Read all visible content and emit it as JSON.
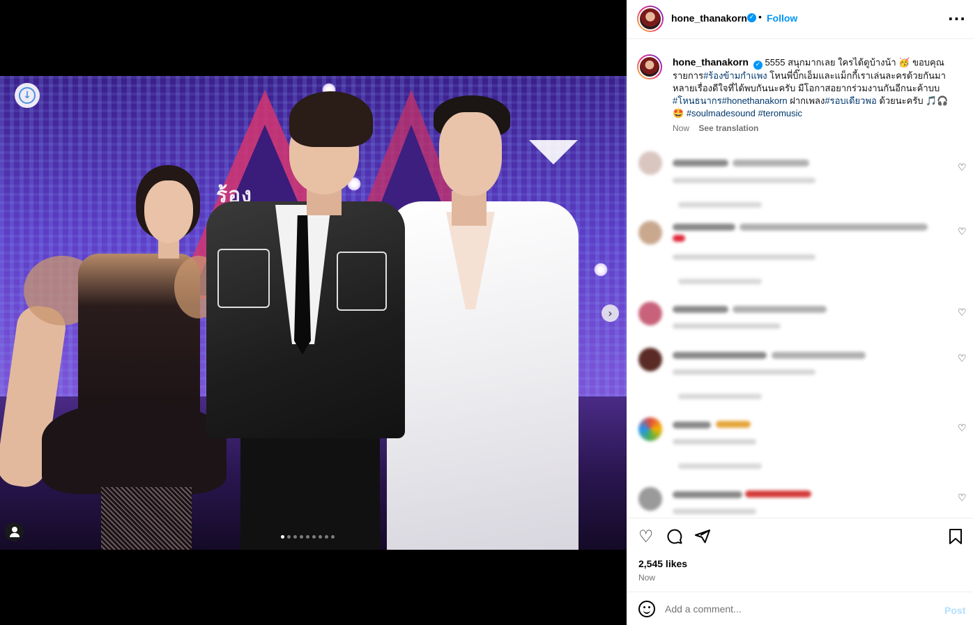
{
  "post": {
    "author": "hone_thanakorn",
    "follow_label": "Follow",
    "separator": "•",
    "more_icon": "more-horizontal-icon"
  },
  "media": {
    "stage_logo": "ร้อง",
    "carousel": {
      "count": 9,
      "current": 1
    },
    "icons": [
      "download-icon",
      "chevron-right-icon",
      "user-tag-icon"
    ]
  },
  "caption": {
    "username": "hone_thanakorn",
    "line1": "5555 สนุกมากเลย ใครได้ดูบ้างน้า 🥳 ขอบคุณ",
    "line2_a": "รายการ",
    "tag1": "#ร้องข้ามกำแพง",
    "line2_b": " โหนพี่บิ๊กเอ็มและแม็กกี้เราเล่นละครด้วยกันมา",
    "line3": "หลายเรื่องดีใจที่ได้พบกันนะครับ มีโอกาสอยากร่วมงานกันอีกนะค้าบบ",
    "tag2": "#โหนธนากร",
    "tag3": "#honethanakorn",
    "line4_a": " ฝากเพลง",
    "tag4": "#รอบเดียวพอ",
    "line4_b": " ด้วยนะครับ 🎵🎧",
    "emoji5": "🤩 ",
    "tag5": "#soulmadesound",
    "tag6": "#teromusic",
    "time": "Now",
    "translate": "See translation"
  },
  "comments_blurred": [
    "blurred-comment-1",
    "blurred-comment-2",
    "blurred-comment-3",
    "blurred-comment-4",
    "blurred-comment-5",
    "blurred-comment-6"
  ],
  "actions": {
    "like_icon": "heart-icon",
    "comment_icon": "comment-icon",
    "share_icon": "share-icon",
    "save_icon": "bookmark-icon",
    "likes": "2,545 likes",
    "time": "Now"
  },
  "add_comment": {
    "placeholder": "Add a comment...",
    "post_label": "Post"
  },
  "colors": {
    "accent": "#0095f6",
    "link": "#00376b",
    "muted": "#737373",
    "post_disabled": "#b2dffc"
  }
}
